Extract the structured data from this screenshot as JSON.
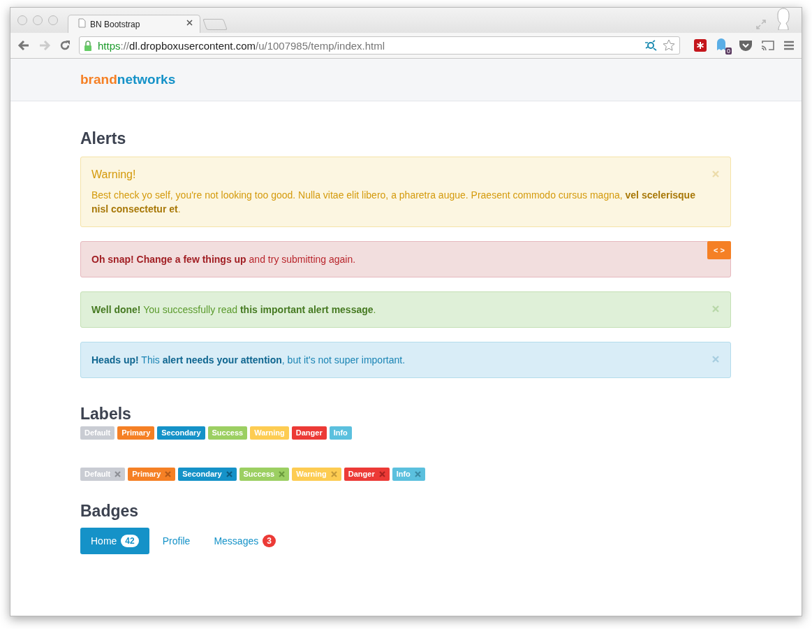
{
  "browser": {
    "tab": {
      "title": "BN Bootstrap"
    },
    "url": {
      "scheme": "https",
      "separator": "://",
      "host": "dl.dropboxusercontent.com",
      "path": "/u/1007985/temp/index.html"
    },
    "extension_count": "0"
  },
  "brand": {
    "first": "brand",
    "second": "networks"
  },
  "alerts_section": {
    "title": "Alerts",
    "alerts": [
      {
        "kind": "warning",
        "heading": "Warning!",
        "text": "Best check yo self, you're not looking too good. Nulla vitae elit libero, a pharetra augue. Praesent commodo cursus magna, **vel scelerisque nisl consectetur et**."
      },
      {
        "kind": "danger",
        "text": "**Oh snap! Change a few things up** and try submitting again.",
        "code_toggle": "< >"
      },
      {
        "kind": "success",
        "text": "**Well done!** You successfully read **this important alert message**."
      },
      {
        "kind": "info",
        "text": "**Heads up!** This **alert needs your attention**, but it's not super important."
      }
    ]
  },
  "labels_section": {
    "title": "Labels",
    "labels": [
      {
        "kind": "default",
        "text": "Default"
      },
      {
        "kind": "primary",
        "text": "Primary"
      },
      {
        "kind": "secondary",
        "text": "Secondary"
      },
      {
        "kind": "success",
        "text": "Success"
      },
      {
        "kind": "warning",
        "text": "Warning"
      },
      {
        "kind": "danger",
        "text": "Danger"
      },
      {
        "kind": "info",
        "text": "Info"
      }
    ],
    "removable_labels": [
      {
        "kind": "default",
        "text": "Default"
      },
      {
        "kind": "primary",
        "text": "Primary"
      },
      {
        "kind": "secondary",
        "text": "Secondary"
      },
      {
        "kind": "success",
        "text": "Success"
      },
      {
        "kind": "warning",
        "text": "Warning"
      },
      {
        "kind": "danger",
        "text": "Danger"
      },
      {
        "kind": "info",
        "text": "Info"
      }
    ]
  },
  "badges_section": {
    "title": "Badges",
    "nav": [
      {
        "label": "Home",
        "badge": "42",
        "selected": true
      },
      {
        "label": "Profile",
        "selected": false
      },
      {
        "label": "Messages",
        "badge": "3",
        "selected": false
      }
    ]
  }
}
